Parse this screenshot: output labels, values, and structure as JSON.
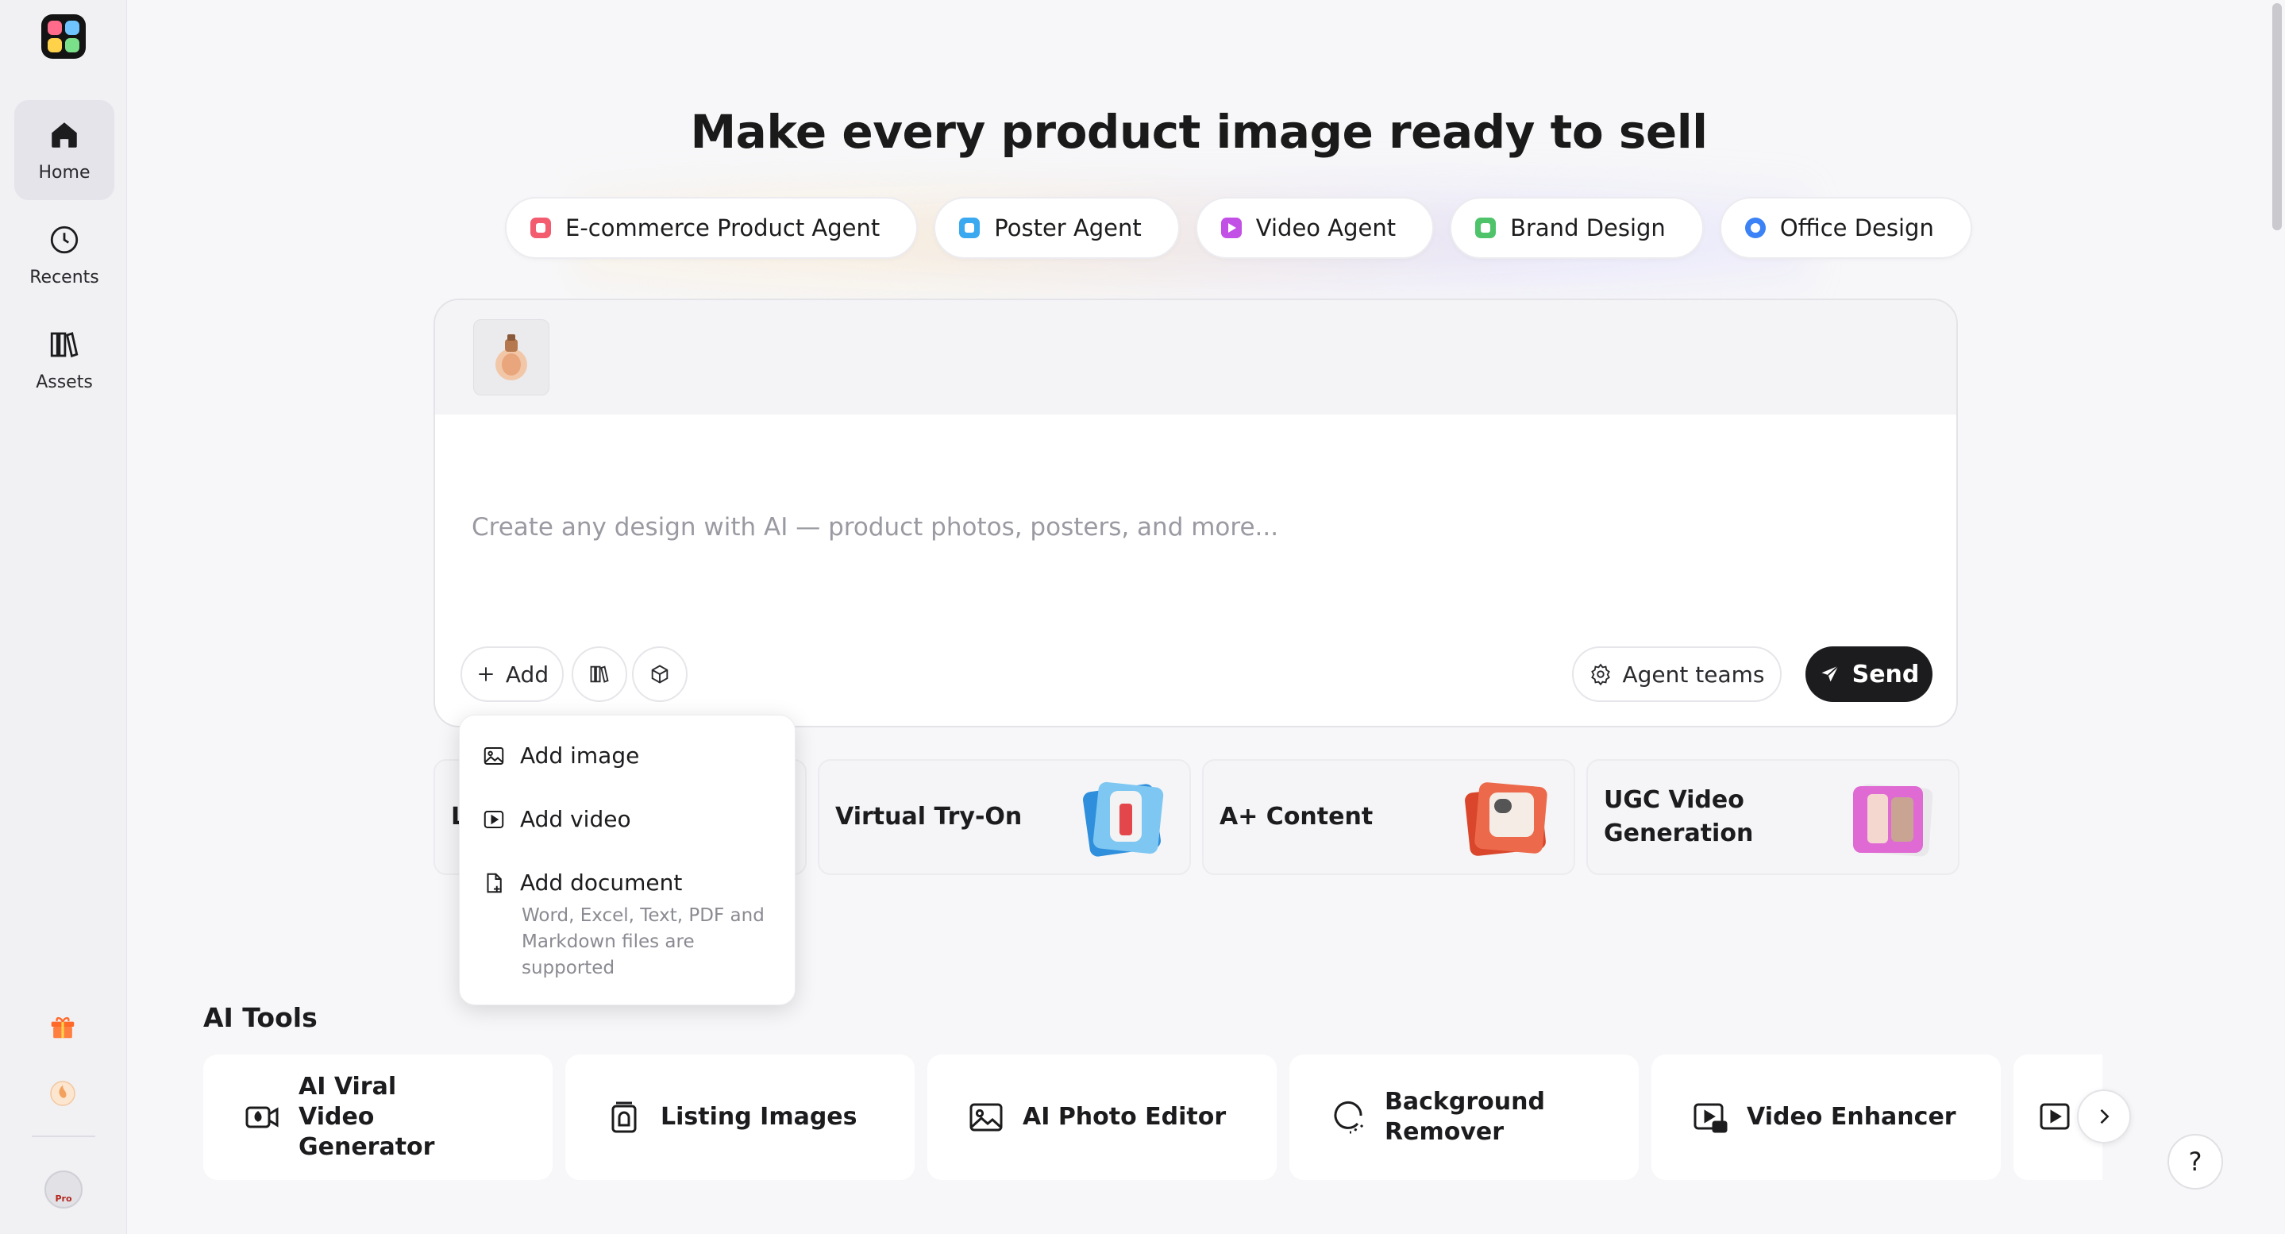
{
  "sidebar": {
    "items": [
      {
        "label": "Home",
        "icon": "home-icon",
        "active": true
      },
      {
        "label": "Recents",
        "icon": "clock-icon"
      },
      {
        "label": "Assets",
        "icon": "library-icon"
      }
    ],
    "bottom": {
      "gift_icon": "gift-icon",
      "credits_icon": "credit-coin-icon",
      "avatar_badge": "Pro"
    }
  },
  "main": {
    "title": "Make every product image ready to sell",
    "agents": [
      {
        "label": "E-commerce Product Agent",
        "color": "#f25c6e"
      },
      {
        "label": "Poster Agent",
        "color": "#3aa9f0"
      },
      {
        "label": "Video Agent",
        "color": "#c24fe6"
      },
      {
        "label": "Brand Design",
        "color": "#4fc36a"
      },
      {
        "label": "Office Design",
        "color": "#3b82f6"
      }
    ],
    "prompt": {
      "placeholder": "Create any design with AI — product photos, posters, and more...",
      "value": "",
      "add_label": "Add",
      "agent_teams_label": "Agent teams",
      "send_label": "Send"
    },
    "add_menu": {
      "items": [
        {
          "label": "Add image",
          "icon": "image-icon"
        },
        {
          "label": "Add video",
          "icon": "video-icon"
        },
        {
          "label": "Add document",
          "icon": "document-icon"
        }
      ],
      "document_note": "Word, Excel, Text, PDF and Markdown files are supported"
    },
    "feature_cards": [
      {
        "label": "L"
      },
      {
        "label": "Virtual Try-On"
      },
      {
        "label": "A+ Content"
      },
      {
        "label": "UGC Video Generation"
      }
    ],
    "ai_tools": {
      "title": "AI Tools",
      "items": [
        {
          "label": "AI Viral Video Generator",
          "icon": "viral-video-icon"
        },
        {
          "label": "Listing Images",
          "icon": "listing-images-icon"
        },
        {
          "label": "AI Photo Editor",
          "icon": "photo-editor-icon"
        },
        {
          "label": "Background Remover",
          "icon": "background-remover-icon"
        },
        {
          "label": "Video Enhancer",
          "icon": "video-enhancer-icon"
        }
      ]
    },
    "help_label": "?",
    "colors": {
      "accent": "#1c1c1e",
      "background": "#f7f7f9",
      "sidebar": "#f1f1f4"
    }
  }
}
